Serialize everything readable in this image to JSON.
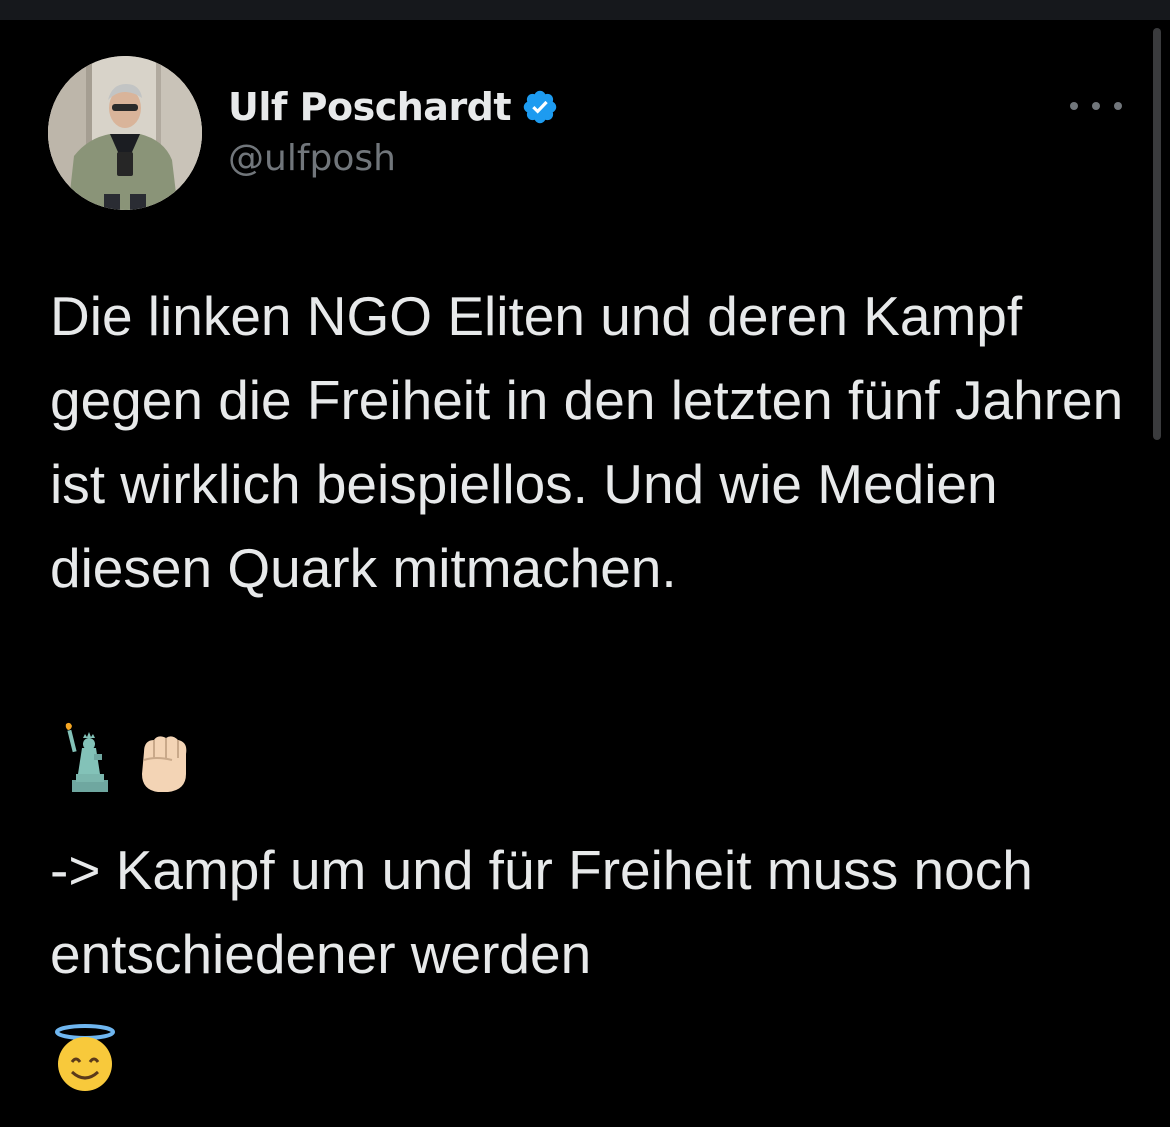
{
  "author": {
    "display_name": "Ulf Poschardt",
    "handle": "@ulfposh",
    "verified": true
  },
  "tweet": {
    "paragraph_1": "Die linken NGO Eliten und deren Kampf gegen die Freiheit in den letzten fünf Jahren ist wirklich beispiellos. Und wie Medien diesen Quark mitmachen.",
    "emoji_row_1": [
      "statue-of-liberty-emoji",
      "raised-fist-emoji"
    ],
    "paragraph_2": "-> Kampf um und für Freiheit muss noch entschiedener werden",
    "emoji_row_2": [
      "smiling-face-with-halo-emoji"
    ]
  },
  "icons": {
    "verified": "verified-badge-icon",
    "more": "more-options-icon"
  },
  "colors": {
    "background": "#000000",
    "text_primary": "#e7e9ea",
    "text_secondary": "#71767b",
    "verified_blue": "#1d9bf0"
  }
}
